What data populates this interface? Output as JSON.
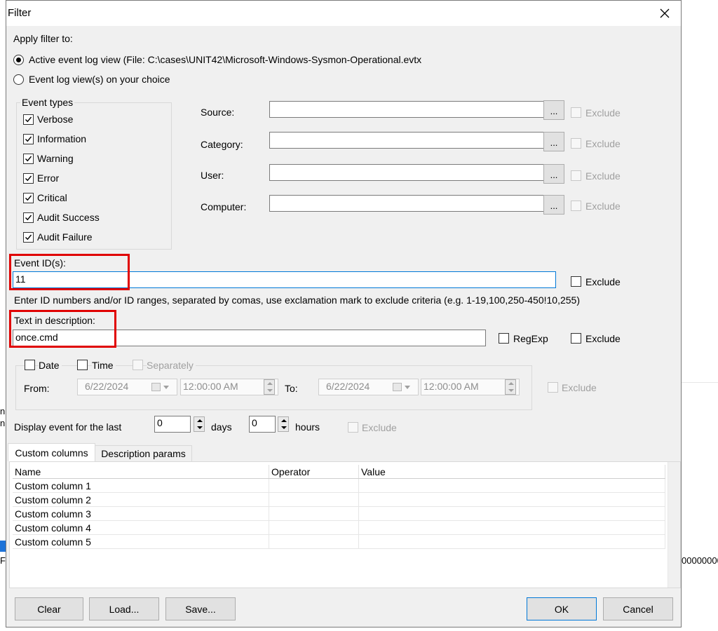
{
  "background": {
    "frag_left1": "n",
    "frag_left2": "n",
    "frag_left3": "F",
    "frag_right": "00000000"
  },
  "dialog": {
    "title": "Filter",
    "close_icon": "close-icon"
  },
  "apply": {
    "label": "Apply filter to:",
    "option_active": "Active event log view (File: C:\\cases\\UNIT42\\Microsoft-Windows-Sysmon-Operational.evtx",
    "option_choice": "Event log view(s) on your choice",
    "selected": "active"
  },
  "event_types": {
    "legend": "Event types",
    "items": [
      {
        "label": "Verbose",
        "checked": true
      },
      {
        "label": "Information",
        "checked": true
      },
      {
        "label": "Warning",
        "checked": true
      },
      {
        "label": "Error",
        "checked": true
      },
      {
        "label": "Critical",
        "checked": true
      },
      {
        "label": "Audit Success",
        "checked": true
      },
      {
        "label": "Audit Failure",
        "checked": true
      }
    ]
  },
  "fields": {
    "source": {
      "label": "Source:",
      "value": "",
      "browse": "...",
      "exclude": "Exclude"
    },
    "category": {
      "label": "Category:",
      "value": "",
      "browse": "...",
      "exclude": "Exclude"
    },
    "user": {
      "label": "User:",
      "value": "",
      "browse": "...",
      "exclude": "Exclude"
    },
    "computer": {
      "label": "Computer:",
      "value": "",
      "browse": "...",
      "exclude": "Exclude"
    }
  },
  "event_ids": {
    "label": "Event ID(s):",
    "value": "11",
    "exclude": "Exclude",
    "hint": "Enter ID numbers and/or ID ranges, separated by comas, use exclamation mark to exclude criteria (e.g. 1-19,100,250-450!10,255)"
  },
  "text_desc": {
    "label": "Text in description:",
    "value": "once.cmd",
    "regexp": "RegExp",
    "exclude": "Exclude"
  },
  "datetime": {
    "date": "Date",
    "time": "Time",
    "separately": "Separately",
    "from": "From:",
    "to": "To:",
    "from_date": "6/22/2024",
    "from_time": "12:00:00 AM",
    "to_date": "6/22/2024",
    "to_time": "12:00:00 AM",
    "exclude": "Exclude"
  },
  "last": {
    "label": "Display event for the last",
    "days_value": "0",
    "days": "days",
    "hours_value": "0",
    "hours": "hours",
    "exclude": "Exclude"
  },
  "tabs": [
    {
      "label": "Custom columns",
      "active": true
    },
    {
      "label": "Description params",
      "active": false
    }
  ],
  "columns_table": {
    "headers": [
      "Name",
      "Operator",
      "Value"
    ],
    "rows": [
      [
        "Custom column 1",
        "",
        ""
      ],
      [
        "Custom column 2",
        "",
        ""
      ],
      [
        "Custom column 3",
        "",
        ""
      ],
      [
        "Custom column 4",
        "",
        ""
      ],
      [
        "Custom column 5",
        "",
        ""
      ]
    ]
  },
  "buttons": {
    "clear": "Clear",
    "load": "Load...",
    "save": "Save...",
    "ok": "OK",
    "cancel": "Cancel"
  },
  "colors": {
    "highlight": "#e00000",
    "focus": "#0078d7"
  }
}
